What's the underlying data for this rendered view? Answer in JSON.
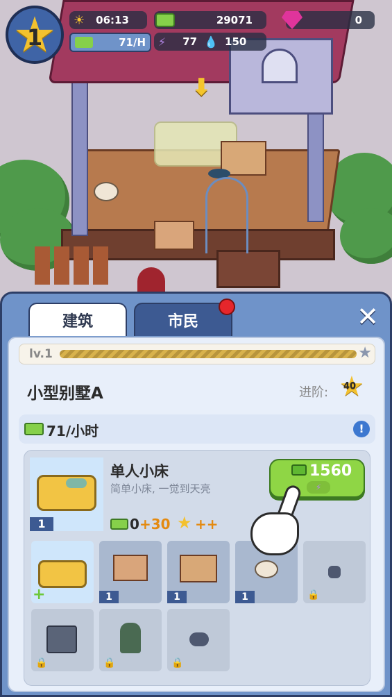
{
  "hud": {
    "level": "1",
    "time": "06:13",
    "cash": "29071",
    "gems": "0",
    "income": "71/H",
    "energy": "77",
    "water": "150"
  },
  "panel": {
    "tabs": [
      {
        "label": "建筑"
      },
      {
        "label": "市民"
      }
    ],
    "level_label": "lv.1",
    "building_name": "小型别墅A",
    "upgrade_label": "进阶:",
    "upgrade_stars": "40",
    "income_rate": "71/小时",
    "item": {
      "name": "单人小床",
      "desc": "简单小床, 一觉到天亮",
      "count": "1",
      "bonus_base": "0",
      "bonus_add": "+30",
      "star_bonus": "++",
      "price": "1560"
    },
    "slots": [
      {
        "name": "bed",
        "count": "",
        "state": "selected"
      },
      {
        "name": "stove",
        "count": "1",
        "state": "owned"
      },
      {
        "name": "desk",
        "count": "1",
        "state": "owned"
      },
      {
        "name": "toilet",
        "count": "1",
        "state": "owned"
      },
      {
        "name": "locked-1",
        "count": "",
        "state": "locked"
      },
      {
        "name": "locked-2",
        "count": "",
        "state": "locked"
      },
      {
        "name": "locked-3",
        "count": "",
        "state": "locked"
      },
      {
        "name": "locked-4",
        "count": "",
        "state": "locked"
      }
    ]
  },
  "colors": {
    "accent": "#6f93c9",
    "dark": "#2d3e66",
    "green": "#8fd645",
    "gold": "#f3c12e"
  }
}
